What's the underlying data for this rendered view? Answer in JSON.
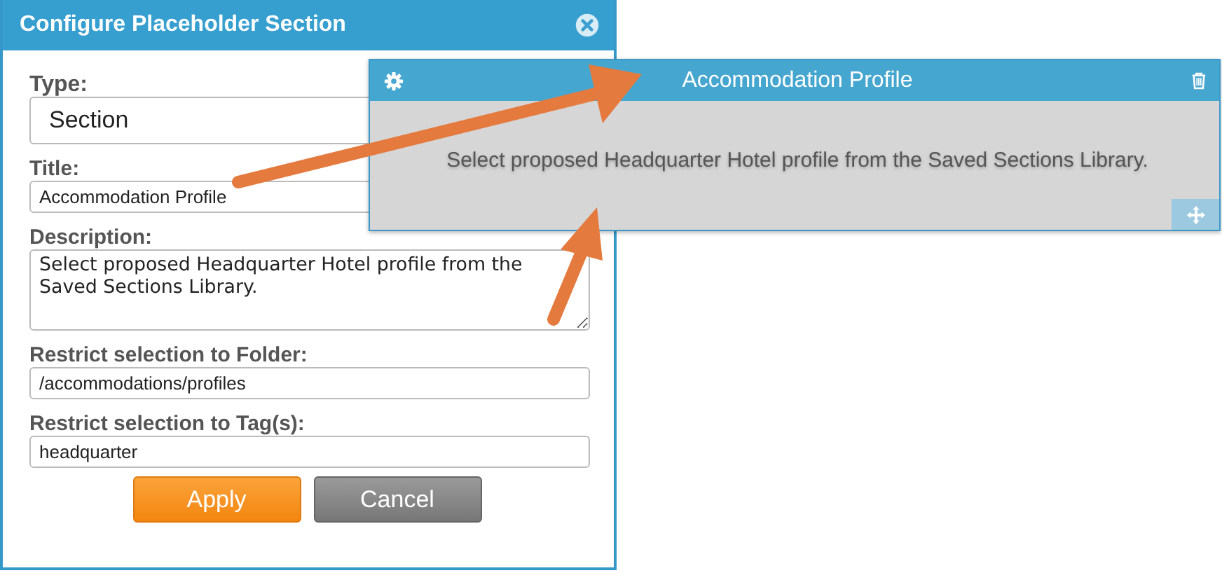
{
  "dialog": {
    "title": "Configure Placeholder Section",
    "fields": [
      {
        "kind": "select",
        "label": "Type:",
        "value": "Section"
      },
      {
        "kind": "text",
        "label": "Title:",
        "value": "Accommodation Profile"
      },
      {
        "kind": "textarea",
        "label": "Description:",
        "value": "Select proposed Headquarter Hotel profile from the Saved Sections Library."
      },
      {
        "kind": "text",
        "label": "Restrict selection to Folder:",
        "value": "/accommodations/profiles"
      },
      {
        "kind": "text",
        "label": "Restrict selection to Tag(s):",
        "value": "headquarter"
      }
    ],
    "buttons": [
      {
        "kind": "primary",
        "label": "Apply"
      },
      {
        "kind": "secondary",
        "label": "Cancel"
      }
    ]
  },
  "panel": {
    "title": "Accommodation Profile",
    "body": "Select proposed Headquarter Hotel profile from the Saved Sections Library."
  }
}
